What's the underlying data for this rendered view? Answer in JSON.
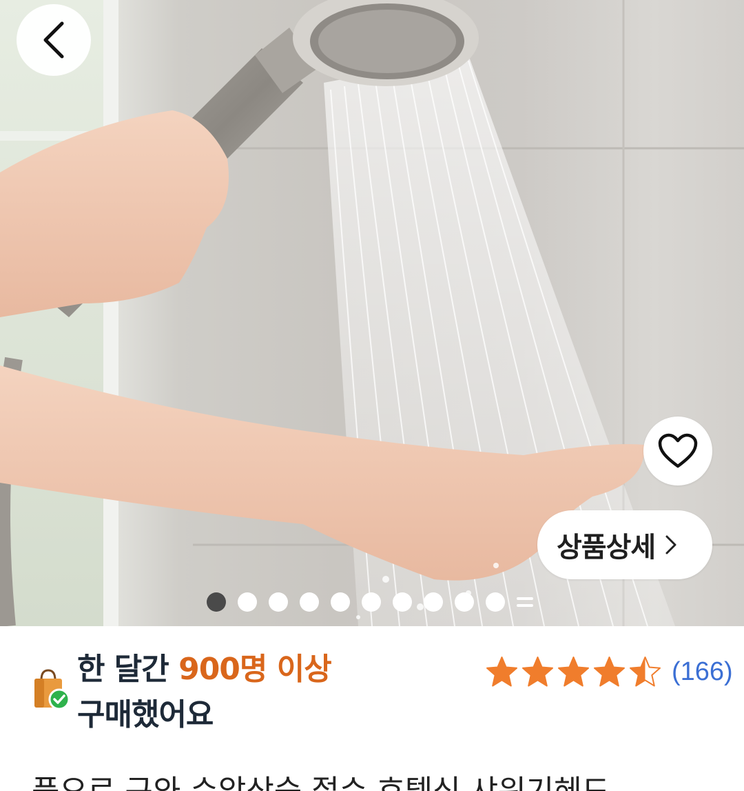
{
  "nav": {
    "back_icon": "chevron-left-icon"
  },
  "hero": {
    "image_alt": "shower head photo",
    "wishlist_icon": "heart-outline-icon",
    "detail_button_label": "상품상세",
    "detail_button_icon": "chevron-right-icon",
    "carousel": {
      "total_dots": 10,
      "active_index": 0,
      "has_more": true
    }
  },
  "purchase_badge": {
    "icon": "shopping-bag-check-icon",
    "prefix": "한 달간 ",
    "highlight": "900명 이상",
    "suffix": "구매했어요"
  },
  "rating": {
    "score": 4.5,
    "max": 5,
    "review_count": "(166)"
  },
  "product": {
    "title_partial": "풍요로 구와 수압상승 절수 호텔식 샤워기헤드"
  },
  "colors": {
    "highlight_orange": "#d9661b",
    "star_orange": "#f07d2c",
    "link_blue": "#3b6fd4",
    "dark_text": "#1e2a38"
  }
}
